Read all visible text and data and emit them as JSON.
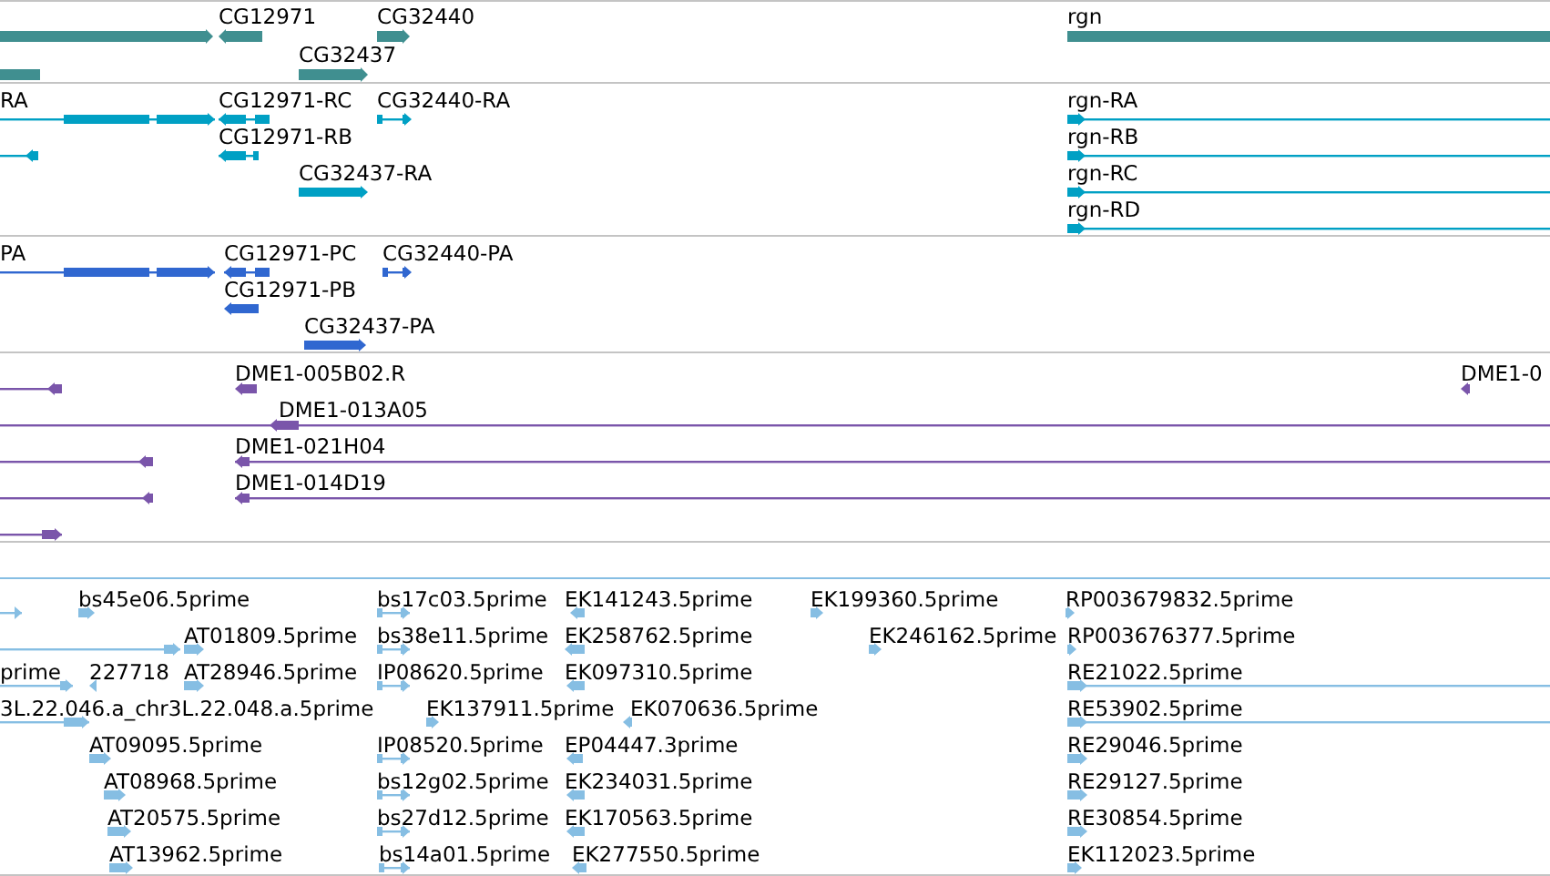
{
  "tracks": [
    {
      "kind": "genes",
      "color": "#408f90",
      "features": [
        {
          "reverse": false
        },
        {
          "label": "CG12971",
          "reverse": true
        },
        {
          "label": "CG32440",
          "reverse": false
        },
        {
          "label": "CG32437",
          "reverse": false
        },
        {
          "reverse": true
        },
        {
          "label": "rgn",
          "reverse": false
        }
      ]
    },
    {
      "kind": "transcripts",
      "color": "#00a0c4",
      "features": [
        {
          "label": "RA",
          "reverse": false
        },
        {
          "label": "CG12971-RC",
          "reverse": true
        },
        {
          "label": "CG32440-RA",
          "reverse": false
        },
        {
          "label": "CG12971-RB",
          "reverse": true
        },
        {
          "reverse": true
        },
        {
          "label": "CG32437-RA",
          "reverse": false
        },
        {
          "label": "rgn-RA",
          "reverse": false
        },
        {
          "label": "rgn-RB",
          "reverse": false
        },
        {
          "label": "rgn-RC",
          "reverse": false
        },
        {
          "label": "rgn-RD",
          "reverse": false
        }
      ]
    },
    {
      "kind": "proteins",
      "color": "#3067d0",
      "features": [
        {
          "label": "PA",
          "reverse": false
        },
        {
          "label": "CG12971-PC",
          "reverse": true
        },
        {
          "label": "CG32440-PA",
          "reverse": false
        },
        {
          "label": "CG12971-PB",
          "reverse": true
        },
        {
          "label": "CG32437-PA",
          "reverse": false
        }
      ]
    },
    {
      "kind": "clones",
      "color": "#7a55aa",
      "features": [
        {
          "reverse": true
        },
        {
          "label": "DME1-005B02.R",
          "reverse": true
        },
        {
          "label": "DME1-0",
          "reverse": true
        },
        {
          "label": "DME1-013A05",
          "reverse": true
        },
        {
          "reverse": true
        },
        {
          "label": "DME1-021H04",
          "reverse": true
        },
        {
          "reverse": true
        },
        {
          "label": "DME1-014D19",
          "reverse": true
        },
        {
          "reverse": false
        }
      ]
    },
    {
      "kind": "empty"
    },
    {
      "kind": "ests",
      "color": "#86bee3",
      "features": [
        {
          "reverse": false
        },
        {
          "label": "bs45e06.5prime",
          "reverse": false
        },
        {
          "label": "bs17c03.5prime",
          "reverse": false
        },
        {
          "label": "EK141243.5prime",
          "reverse": true
        },
        {
          "label": "EK199360.5prime",
          "reverse": false
        },
        {
          "label": "RP003679832.5prime",
          "reverse": false
        },
        {
          "reverse": false
        },
        {
          "label": "AT01809.5prime",
          "reverse": false
        },
        {
          "label": "bs38e11.5prime",
          "reverse": false
        },
        {
          "label": "EK258762.5prime",
          "reverse": true
        },
        {
          "label": "EK246162.5prime",
          "reverse": false
        },
        {
          "label": "RP003676377.5prime",
          "reverse": false
        },
        {
          "label": "prime",
          "reverse": false
        },
        {
          "label": "227718",
          "reverse": true
        },
        {
          "label": "AT28946.5prime",
          "reverse": false
        },
        {
          "label": "IP08620.5prime",
          "reverse": false
        },
        {
          "label": "EK097310.5prime",
          "reverse": true
        },
        {
          "label": "RE21022.5prime",
          "reverse": false
        },
        {
          "label": "3L.22.046.a_chr3L.22.048.a.5prime",
          "reverse": false
        },
        {
          "label": "EK137911.5prime",
          "reverse": false
        },
        {
          "label": "EK070636.5prime",
          "reverse": true
        },
        {
          "label": "RE53902.5prime",
          "reverse": false
        },
        {
          "label": "AT09095.5prime",
          "reverse": false
        },
        {
          "label": "IP08520.5prime",
          "reverse": false
        },
        {
          "label": "EP04447.3prime",
          "reverse": true
        },
        {
          "label": "RE29046.5prime",
          "reverse": false
        },
        {
          "label": "AT08968.5prime",
          "reverse": false
        },
        {
          "label": "bs12g02.5prime",
          "reverse": false
        },
        {
          "label": "EK234031.5prime",
          "reverse": true
        },
        {
          "label": "RE29127.5prime",
          "reverse": false
        },
        {
          "label": "AT20575.5prime",
          "reverse": false
        },
        {
          "label": "bs27d12.5prime",
          "reverse": false
        },
        {
          "label": "EK170563.5prime",
          "reverse": true
        },
        {
          "label": "RE30854.5prime",
          "reverse": false
        },
        {
          "label": "AT13962.5prime",
          "reverse": false
        },
        {
          "label": "bs14a01.5prime",
          "reverse": false
        },
        {
          "label": "EK277550.5prime",
          "reverse": true
        },
        {
          "label": "EK112023.5prime",
          "reverse": false
        }
      ]
    }
  ]
}
